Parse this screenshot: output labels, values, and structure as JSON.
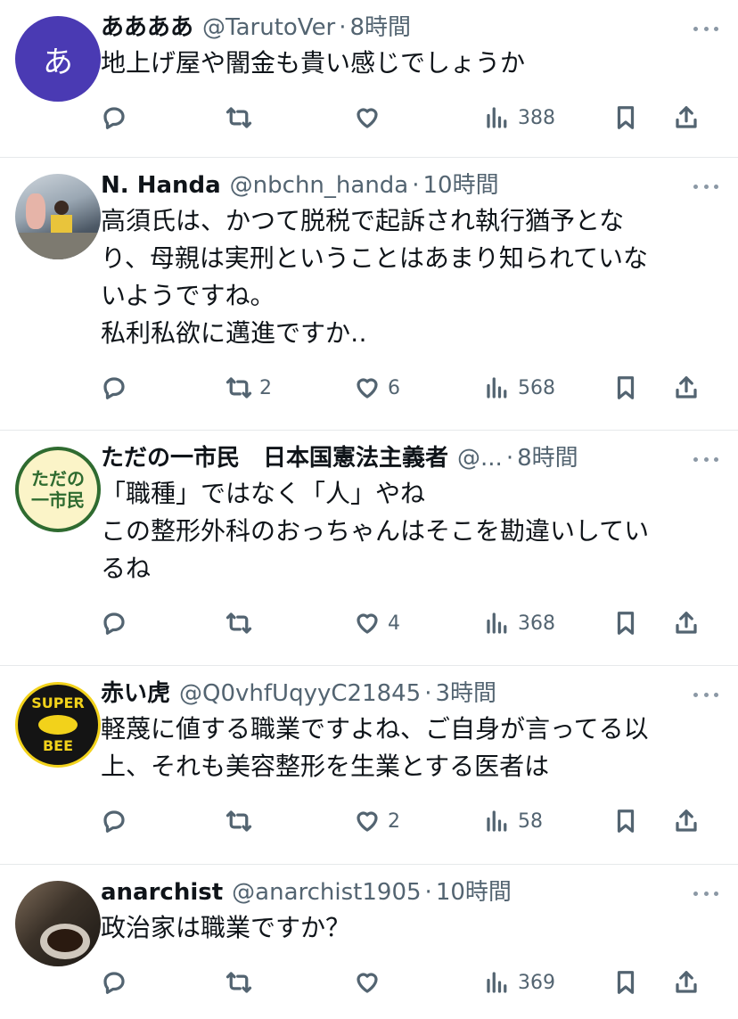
{
  "tweets": [
    {
      "name": "ああああ",
      "handle": "@TarutoVer",
      "dot": "·",
      "time": "8時間",
      "avatar_letter": "あ",
      "avatar_color": "#4a3ab3",
      "text": "地上げ屋や闇金も貴い感じでしょうか",
      "replies": "",
      "retweets": "",
      "likes": "",
      "views": "388"
    },
    {
      "name": "N. Handa",
      "handle": "@nbchn_handa",
      "dot": "·",
      "time": "10時間",
      "text": "高須氏は、かつて脱税で起訴され執行猶予とな\nり、母親は実刑ということはあまり知られていな\nいようですね。\n私利私欲に邁進ですか‥",
      "replies": "",
      "retweets": "2",
      "likes": "6",
      "views": "568"
    },
    {
      "name": "ただの一市民　日本国憲法主義者",
      "handle": "@...",
      "dot": "·",
      "time": "8時間",
      "avatar_line1": "ただの",
      "avatar_line2": "一市民",
      "text": "「職種」ではなく「人」やね\nこの整形外科のおっちゃんはそこを勘違いしてい\nるね",
      "replies": "",
      "retweets": "",
      "likes": "4",
      "views": "368"
    },
    {
      "name": "赤い虎",
      "handle": "@Q0vhfUqyyC21845",
      "dot": "·",
      "time": "3時間",
      "avatar_top": "SUPER",
      "avatar_bottom": "BEE",
      "text": "軽蔑に値する職業ですよね、ご自身が言ってる以\n上、それも美容整形を生業とする医者は",
      "replies": "",
      "retweets": "",
      "likes": "2",
      "views": "58"
    },
    {
      "name": "anarchist",
      "handle": "@anarchist1905",
      "dot": "·",
      "time": "10時間",
      "text": "政治家は職業ですか？",
      "replies": "",
      "retweets": "",
      "likes": "",
      "views": "369"
    }
  ],
  "icons": [
    "reply-icon",
    "retweet-icon",
    "like-icon",
    "views-icon",
    "bookmark-icon",
    "share-icon",
    "more-icon"
  ]
}
